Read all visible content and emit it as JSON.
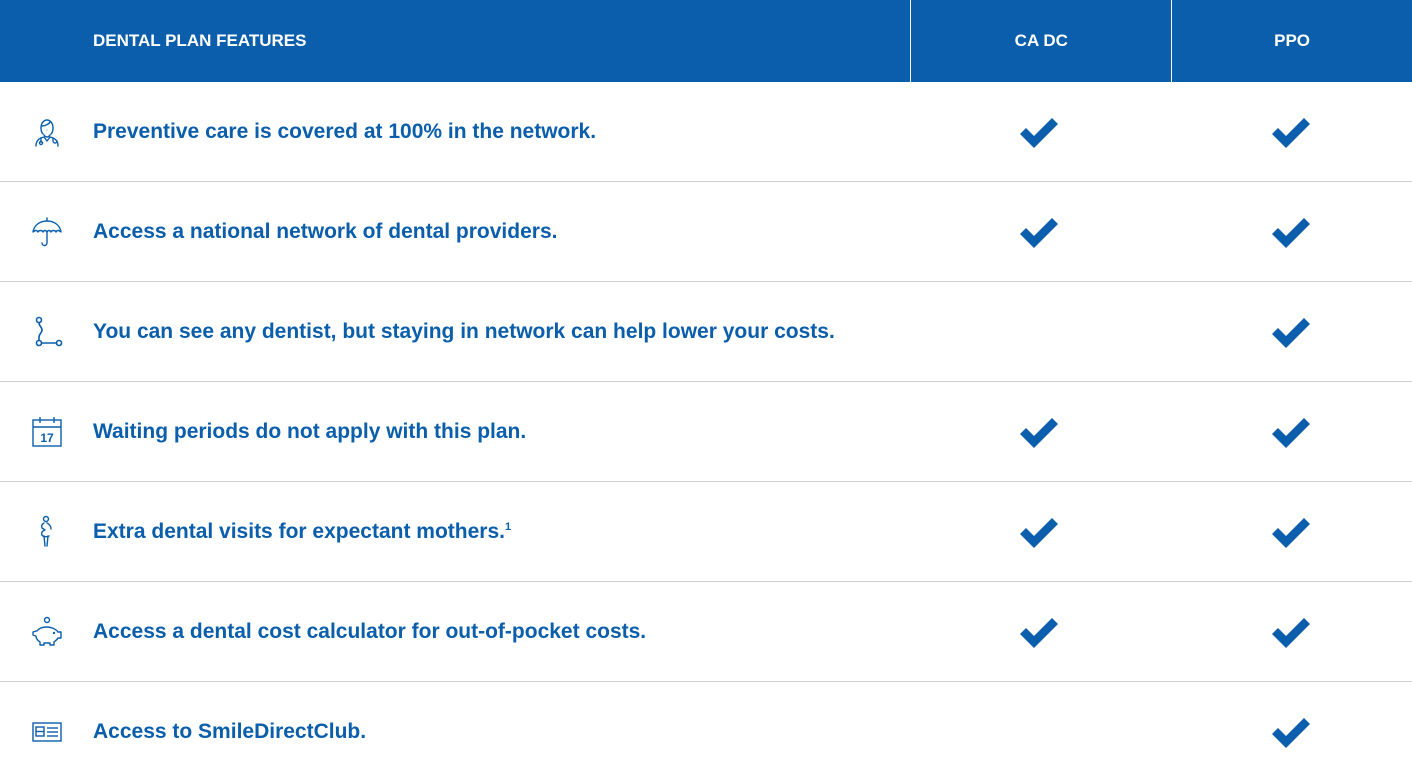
{
  "header": {
    "features_label": "DENTAL PLAN FEATURES",
    "col1_label": "CA DC",
    "col2_label": "PPO"
  },
  "colors": {
    "brand_blue": "#0a5eab",
    "divider": "#cfcfcf"
  },
  "rows": [
    {
      "icon": "doctor-icon",
      "text": "Preventive care is covered at 100% in the network.",
      "sup": "",
      "col1": true,
      "col2": true
    },
    {
      "icon": "umbrella-icon",
      "text": "Access a national network of dental providers.",
      "sup": "",
      "col1": true,
      "col2": true
    },
    {
      "icon": "route-icon",
      "text": "You can see any dentist, but staying in network can help lower your costs.",
      "sup": "",
      "col1": false,
      "col2": true
    },
    {
      "icon": "calendar-icon",
      "text": "Waiting periods do not apply with this plan.",
      "sup": "",
      "col1": true,
      "col2": true
    },
    {
      "icon": "pregnant-woman-icon",
      "text": "Extra dental visits for expectant mothers.",
      "sup": "1",
      "col1": true,
      "col2": true
    },
    {
      "icon": "piggy-bank-icon",
      "text": "Access a dental cost calculator for out-of-pocket costs.",
      "sup": "",
      "col1": true,
      "col2": true
    },
    {
      "icon": "id-card-icon",
      "text": "Access to SmileDirectClub.",
      "sup": "",
      "col1": false,
      "col2": true
    }
  ],
  "calendar_icon_day": "17"
}
